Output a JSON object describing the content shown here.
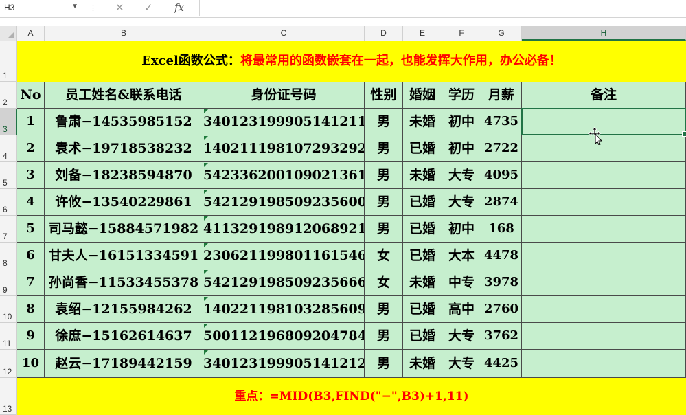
{
  "name_box": {
    "value": "H3"
  },
  "formula_bar": {
    "cancel_icon": "✕",
    "enter_icon": "✓",
    "fx_label": "fx",
    "value": ""
  },
  "columns": [
    "A",
    "B",
    "C",
    "D",
    "E",
    "F",
    "G",
    "H"
  ],
  "rows": [
    "1",
    "2",
    "3",
    "4",
    "5",
    "6",
    "7",
    "8",
    "9",
    "10",
    "11",
    "12",
    "13"
  ],
  "selected_cell": "H3",
  "title": {
    "black": "Excel函数公式：",
    "red": "将最常用的函数嵌套在一起，也能发挥大作用，办公必备！"
  },
  "table": {
    "headers": [
      "No",
      "员工姓名&联系电话",
      "身份证号码",
      "性别",
      "婚姻",
      "学历",
      "月薪",
      "备注"
    ],
    "rows": [
      [
        "1",
        "鲁肃−14535985152",
        "340123199905141211",
        "男",
        "未婚",
        "初中",
        "4735",
        ""
      ],
      [
        "2",
        "袁术−19718538232",
        "140211198107293292",
        "男",
        "已婚",
        "初中",
        "2722",
        ""
      ],
      [
        "3",
        "刘备−18238594870",
        "542336200109021361",
        "男",
        "未婚",
        "大专",
        "4095",
        ""
      ],
      [
        "4",
        "许攸−13540229861",
        "542129198509235600",
        "男",
        "已婚",
        "大专",
        "2874",
        ""
      ],
      [
        "5",
        "司马懿−15884571982",
        "411329198912068921",
        "男",
        "已婚",
        "初中",
        "168",
        ""
      ],
      [
        "6",
        "甘夫人−16151334591",
        "230621199801161546",
        "女",
        "已婚",
        "大本",
        "4478",
        ""
      ],
      [
        "7",
        "孙尚香−11533455378",
        "542129198509235666",
        "女",
        "未婚",
        "中专",
        "3978",
        ""
      ],
      [
        "8",
        "袁绍−12155984262",
        "140221198103285609",
        "男",
        "已婚",
        "高中",
        "2760",
        ""
      ],
      [
        "9",
        "徐庶−15162614637",
        "500112196809204784",
        "男",
        "已婚",
        "大专",
        "3762",
        ""
      ],
      [
        "10",
        "赵云−17189442159",
        "340123199905141212",
        "男",
        "未婚",
        "大专",
        "4425",
        ""
      ]
    ]
  },
  "footer": {
    "text": "重点：=MID(B3,FIND(\"−\",B3)+1,11)"
  },
  "colors": {
    "header_yellow": "#ffff00",
    "grid_green": "#c6efce",
    "title_red": "#ff0000",
    "selection_green": "#217346"
  }
}
